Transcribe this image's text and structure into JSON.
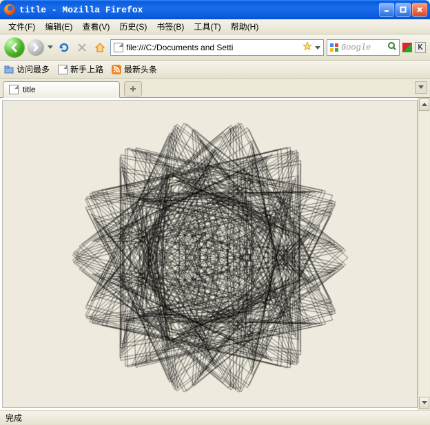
{
  "window": {
    "title": "title - Mozilla Firefox"
  },
  "menu": {
    "file": "文件(F)",
    "edit": "编辑(E)",
    "view": "查看(V)",
    "history": "历史(S)",
    "bookmarks": "书签(B)",
    "tools": "工具(T)",
    "help": "帮助(H)"
  },
  "nav": {
    "url": "file:///C:/Documents and Setti",
    "search_placeholder": "Google"
  },
  "bookmarks_bar": {
    "most_visited": "访问最多",
    "getting_started": "新手上路",
    "latest_headlines": "最新头条"
  },
  "tabs": {
    "active": "title"
  },
  "status": {
    "text": "完成"
  },
  "addon": {
    "k_letter": "K"
  },
  "canvas_art": {
    "points": 7,
    "multiplier": 3,
    "lines": 220,
    "radius": 200
  }
}
